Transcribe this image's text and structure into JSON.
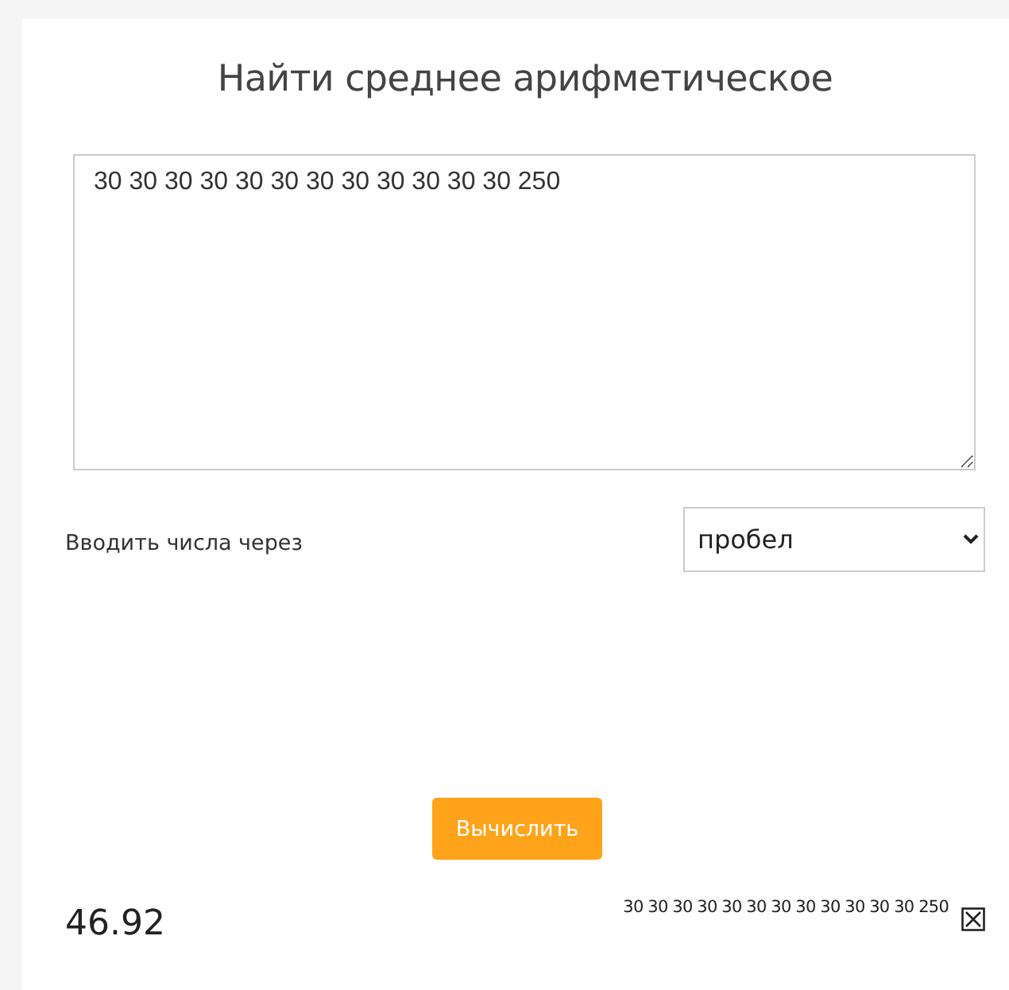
{
  "title": "Найти среднее арифметическое",
  "input": {
    "value": "30 30 30 30 30 30 30 30 30 30 30 30 250"
  },
  "separator": {
    "label": "Вводить числа через",
    "value": "пробел"
  },
  "calculate_button": "Вычислить",
  "result": {
    "value": "46.92",
    "numbers": "30 30 30 30 30 30 30 30 30 30 30 30 250"
  }
}
